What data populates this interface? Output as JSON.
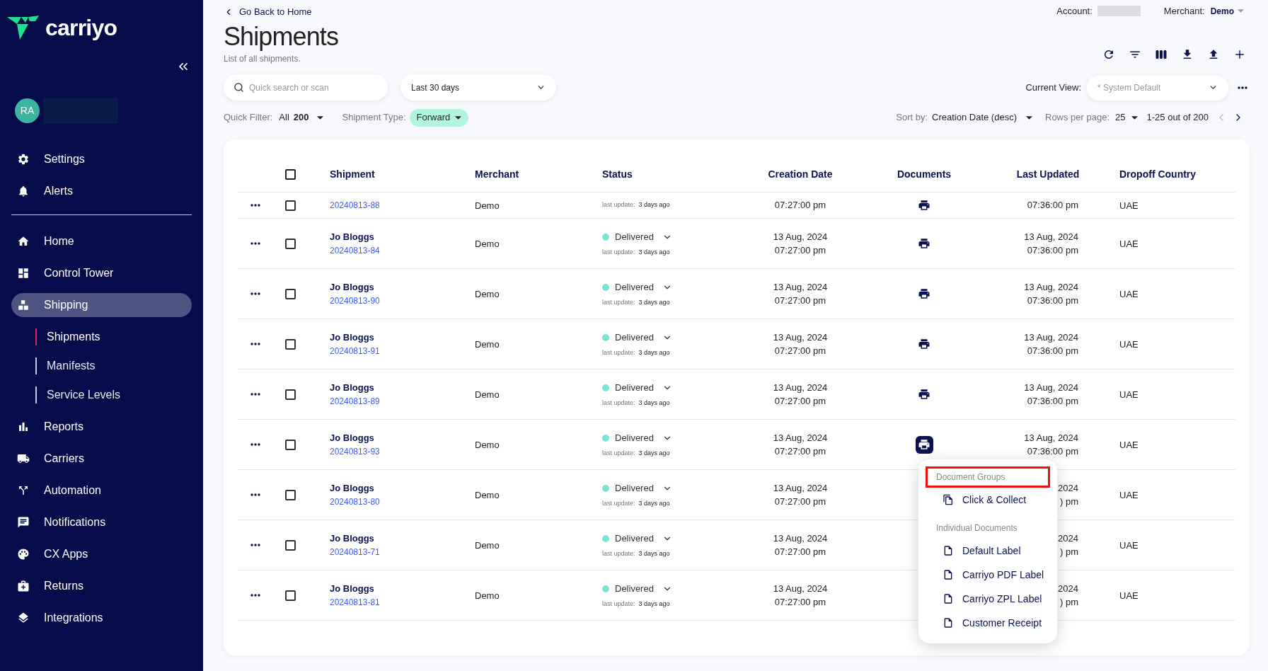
{
  "sidebar": {
    "logo": "carriyo",
    "avatar": "RA",
    "top_items": [
      {
        "label": "Settings",
        "selected": false
      },
      {
        "label": "Alerts",
        "selected": false
      }
    ],
    "nav_items": [
      {
        "label": "Home",
        "selected": false
      },
      {
        "label": "Control Tower",
        "selected": false
      },
      {
        "label": "Shipping",
        "selected": true,
        "children": [
          {
            "label": "Shipments",
            "selected": true
          },
          {
            "label": "Manifests",
            "selected": false
          },
          {
            "label": "Service Levels",
            "selected": false
          }
        ]
      },
      {
        "label": "Reports",
        "selected": false
      },
      {
        "label": "Carriers",
        "selected": false
      },
      {
        "label": "Automation",
        "selected": false
      },
      {
        "label": "Notifications",
        "selected": false
      },
      {
        "label": "CX Apps",
        "selected": false
      },
      {
        "label": "Returns",
        "selected": false
      },
      {
        "label": "Integrations",
        "selected": false
      }
    ]
  },
  "header": {
    "back_link": "Go Back to Home",
    "title": "Shipments",
    "subtitle": "List of all shipments.",
    "account_label": "Account:",
    "merchant_label": "Merchant:",
    "merchant": "Demo"
  },
  "toolbar": {
    "search_placeholder": "Quick search or scan",
    "date_range": "Last 30 days",
    "current_view_label": "Current View:",
    "current_view_placeholder": "* System Default"
  },
  "filters": {
    "quick_filter_label": "Quick Filter:",
    "quick_filter_value": "All",
    "quick_filter_count": "200",
    "type_label": "Shipment Type:",
    "type_value": "Forward",
    "sort_label": "Sort by:",
    "sort_value": "Creation Date (desc)",
    "rows_label": "Rows per page:",
    "rows_value": "25",
    "range": "1-25 out of 200"
  },
  "table": {
    "all_checked": false,
    "columns": [
      "Shipment",
      "Merchant",
      "Status",
      "Creation Date",
      "Documents",
      "Last Updated",
      "Dropoff Country"
    ],
    "rows": [
      {
        "checked": false,
        "doc_open": false,
        "number": "20240813-88",
        "merchant": "Demo",
        "update_label": "last update:",
        "update": "3 days ago",
        "created_time": "07:27:00 pm",
        "updated_time": "07:36:00 pm",
        "country": "UAE"
      },
      {
        "checked": false,
        "doc_open": false,
        "name": "Jo Bloggs",
        "number": "20240813-84",
        "merchant": "Demo",
        "status": "Delivered",
        "update_label": "last update:",
        "update": "3 days ago",
        "created_date": "13 Aug, 2024",
        "created_time": "07:27:00 pm",
        "updated_date": "13 Aug, 2024",
        "updated_time": "07:36:00 pm",
        "country": "UAE"
      },
      {
        "checked": false,
        "doc_open": false,
        "name": "Jo Bloggs",
        "number": "20240813-90",
        "merchant": "Demo",
        "status": "Delivered",
        "update_label": "last update:",
        "update": "3 days ago",
        "created_date": "13 Aug, 2024",
        "created_time": "07:27:00 pm",
        "updated_date": "13 Aug, 2024",
        "updated_time": "07:36:00 pm",
        "country": "UAE"
      },
      {
        "checked": false,
        "doc_open": false,
        "name": "Jo Bloggs",
        "number": "20240813-91",
        "merchant": "Demo",
        "status": "Delivered",
        "update_label": "last update:",
        "update": "3 days ago",
        "created_date": "13 Aug, 2024",
        "created_time": "07:27:00 pm",
        "updated_date": "13 Aug, 2024",
        "updated_time": "07:36:00 pm",
        "country": "UAE"
      },
      {
        "checked": false,
        "doc_open": false,
        "name": "Jo Bloggs",
        "number": "20240813-89",
        "merchant": "Demo",
        "status": "Delivered",
        "update_label": "last update:",
        "update": "3 days ago",
        "created_date": "13 Aug, 2024",
        "created_time": "07:27:00 pm",
        "updated_date": "13 Aug, 2024",
        "updated_time": "07:36:00 pm",
        "country": "UAE"
      },
      {
        "checked": false,
        "doc_open": true,
        "name": "Jo Bloggs",
        "number": "20240813-93",
        "merchant": "Demo",
        "status": "Delivered",
        "update_label": "last update:",
        "update": "3 days ago",
        "created_date": "13 Aug, 2024",
        "created_time": "07:27:00 pm",
        "updated_date": "13 Aug, 2024",
        "updated_time": "07:36:00 pm",
        "country": "UAE"
      },
      {
        "checked": false,
        "name": "Jo Bloggs",
        "number": "20240813-80",
        "merchant": "Demo",
        "status": "Delivered",
        "update_label": "last update:",
        "update": "3 days ago",
        "created_date": "13 Aug, 2024",
        "created_time": "07:27:00 pm",
        "updated_date": "2024",
        "updated_time": ") pm",
        "country": "UAE"
      },
      {
        "checked": false,
        "name": "Jo Bloggs",
        "number": "20240813-71",
        "merchant": "Demo",
        "status": "Delivered",
        "update_label": "last update:",
        "update": "3 days ago",
        "created_date": "13 Aug, 2024",
        "created_time": "07:27:00 pm",
        "updated_date": "2024",
        "updated_time": ") pm",
        "country": "UAE"
      },
      {
        "checked": false,
        "name": "Jo Bloggs",
        "number": "20240813-81",
        "merchant": "Demo",
        "status": "Delivered",
        "update_label": "last update:",
        "update": "3 days ago",
        "created_date": "13 Aug, 2024",
        "created_time": "07:27:00 pm",
        "updated_date": "2024",
        "updated_time": ") pm",
        "country": "UAE"
      }
    ]
  },
  "doc_menu": {
    "groups": [
      {
        "heading": "Document Groups",
        "highlighted": true,
        "items": [
          "Click & Collect"
        ]
      },
      {
        "heading": "Individual Documents",
        "highlighted": false,
        "items": [
          "Default Label",
          "Carriyo PDF Label",
          "Carriyo ZPL Label",
          "Customer Receipt"
        ]
      }
    ]
  }
}
